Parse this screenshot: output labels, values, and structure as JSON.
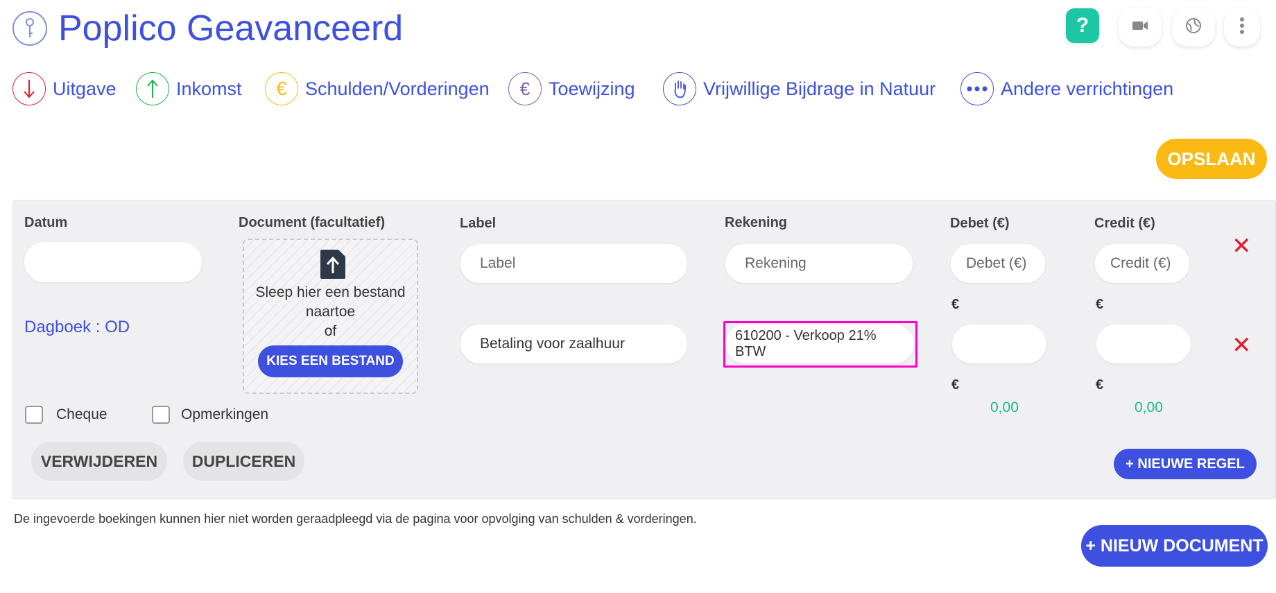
{
  "header": {
    "title": "Poplico Geavanceerd",
    "help_label": "?",
    "icons": [
      "key-icon",
      "video-icon",
      "globe-icon",
      "more-vertical-icon"
    ]
  },
  "nav": [
    {
      "label": "Uitgave",
      "icon": "arrow-down-icon",
      "color": "#e21d2d"
    },
    {
      "label": "Inkomst",
      "icon": "arrow-up-icon",
      "color": "#19b34a"
    },
    {
      "label": "Schulden/Vorderingen",
      "icon": "euro-icon",
      "color": "#fbb914"
    },
    {
      "label": "Toewijzing",
      "icon": "euro-transfer-icon",
      "color": "#7b5cb8"
    },
    {
      "label": "Vrijwillige Bijdrage in Natuur",
      "icon": "hand-icon",
      "color": "#3d50e0"
    },
    {
      "label": "Andere verrichtingen",
      "icon": "ellipsis-icon",
      "color": "#3d50e0"
    }
  ],
  "toolbar": {
    "save_label": "OPSLAAN"
  },
  "entry": {
    "headers": {
      "date": "Datum",
      "document": "Document (facultatief)",
      "label": "Label",
      "account": "Rekening",
      "debit": "Debet (€)",
      "credit": "Credit (€)"
    },
    "dropzone": {
      "text_line1": "Sleep hier een bestand",
      "text_line2": "naartoe",
      "text_line3": "of",
      "button": "KIES EEN BESTAND"
    },
    "journal": "Dagboek : OD",
    "lines": [
      {
        "label_placeholder": "Label",
        "account_placeholder": "Rekening",
        "debit_placeholder": "Debet (€)",
        "credit_placeholder": "Credit (€)",
        "label_value": "",
        "account_value": ""
      },
      {
        "label_value": "Betaling voor zaalhuur",
        "account_value": "610200 - Verkoop 21% BTW",
        "debit_value": "",
        "credit_value": ""
      }
    ],
    "currency_symbol": "€",
    "totals": {
      "debit": "0,00",
      "credit": "0,00"
    },
    "checkboxes": {
      "cheque": "Cheque",
      "remarks": "Opmerkingen"
    },
    "buttons": {
      "delete": "VERWIJDEREN",
      "duplicate": "DUPLICEREN",
      "new_line": "+ NIEUWE REGEL"
    }
  },
  "footer": {
    "note": "De ingevoerde boekingen kunnen hier niet worden geraadpleegd via de pagina voor opvolging van schulden & vorderingen.",
    "new_document": "+ NIEUW DOCUMENT"
  },
  "colors": {
    "accent": "#3d50e0",
    "save": "#fbb914",
    "help": "#1cc7a5",
    "danger": "#e21d2d",
    "total": "#18b98e",
    "highlight": "#ff00c8"
  }
}
